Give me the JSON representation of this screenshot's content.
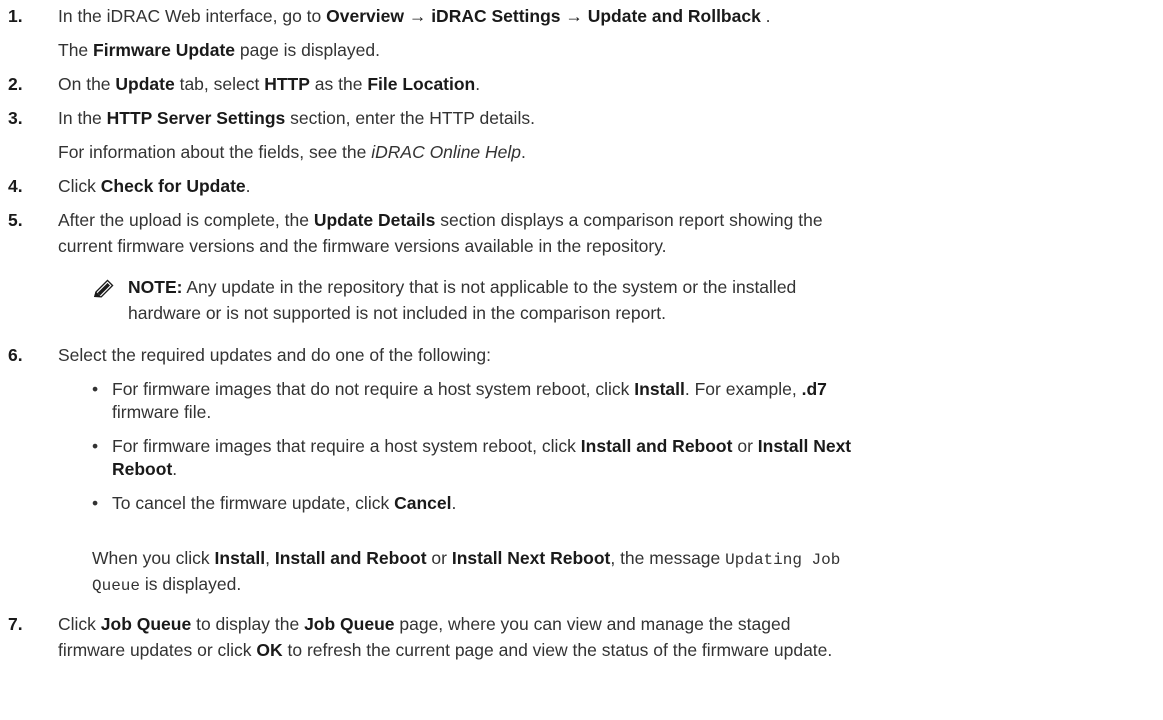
{
  "steps": [
    {
      "num": "1.",
      "a": "In the iDRAC Web interface, go to ",
      "b": "Overview → iDRAC Settings → Update and Rollback",
      "c": " .",
      "sub_a": "The ",
      "sub_b": "Firmware Update",
      "sub_c": " page is displayed."
    },
    {
      "num": "2.",
      "a": "On the ",
      "b": "Update",
      "c": " tab, select ",
      "d": "HTTP",
      "e": " as the ",
      "f": "File Location",
      "g": "."
    },
    {
      "num": "3.",
      "a": "In the ",
      "b": "HTTP Server Settings",
      "c": " section, enter the HTTP details.",
      "sub_a": "For information about the fields, see the ",
      "sub_i": "iDRAC Online Help",
      "sub_c": "."
    },
    {
      "num": "4.",
      "a": "Click ",
      "b": "Check for Update",
      "c": "."
    },
    {
      "num": "5.",
      "a": "After the upload is complete, the ",
      "b": "Update Details",
      "c": " section displays a comparison report showing the",
      "line2": "current firmware versions and the firmware versions available in the repository.",
      "note_label": "NOTE:",
      "note_a": " Any update in the repository that is not applicable to the system or the installed",
      "note_b": "hardware or is not supported is not included in the comparison report."
    },
    {
      "num": "6.",
      "a": "Select the required updates and do one of the following:",
      "bullets": [
        {
          "a": "For firmware images that do not require a host system reboot, click ",
          "b": "Install",
          "c": ". For example, ",
          "d": ".d7",
          "line2": "firmware file."
        },
        {
          "a": "For firmware images that require a host system reboot, click ",
          "b": "Install and Reboot",
          "c": " or ",
          "d": "Install Next",
          "line2": "Reboot",
          "line2_end": "."
        },
        {
          "a": "To cancel the firmware update, click ",
          "b": "Cancel",
          "c": "."
        }
      ],
      "after_a": "When you click ",
      "after_b": "Install",
      "after_c": ", ",
      "after_d": "Install and Reboot",
      "after_e": " or ",
      "after_f": "Install Next Reboot",
      "after_g": ", the message ",
      "after_mono": "Updating Job",
      "after_mono2": "Queue",
      "after_h": " is displayed."
    },
    {
      "num": "7.",
      "a": "Click ",
      "b": "Job Queue",
      "c": " to display the ",
      "d": "Job Queue",
      "e": " page, where you can view and manage the staged",
      "line2_a": "firmware updates or click ",
      "line2_b": "OK",
      "line2_c": " to refresh the current page and view the status of the firmware update."
    }
  ],
  "icons": {
    "note": "pencil-note-icon"
  }
}
